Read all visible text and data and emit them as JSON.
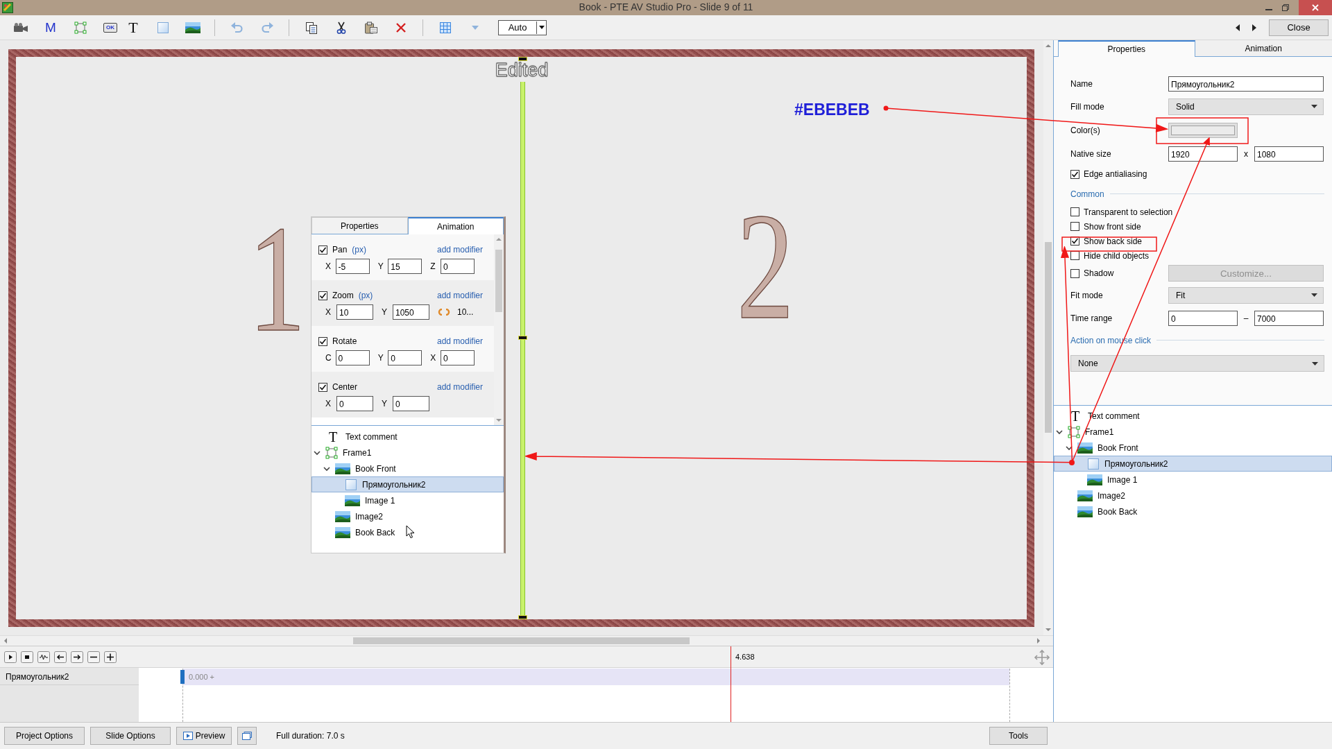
{
  "window": {
    "title": "Book - PTE AV Studio Pro - Slide 9 of 11"
  },
  "toolbar": {
    "tools": [
      {
        "kind": "camera"
      },
      {
        "kind": "glyph",
        "glyph": "M"
      },
      {
        "kind": "frame"
      },
      {
        "kind": "caption",
        "glyph": "OK"
      },
      {
        "kind": "glyph-serif",
        "glyph": "T"
      },
      {
        "kind": "rectangle"
      },
      {
        "kind": "image"
      },
      {
        "kind": "separator"
      },
      {
        "kind": "undo"
      },
      {
        "kind": "redo"
      },
      {
        "kind": "separator"
      },
      {
        "kind": "copy"
      },
      {
        "kind": "cut"
      },
      {
        "kind": "paste"
      },
      {
        "kind": "delete"
      },
      {
        "kind": "separator"
      },
      {
        "kind": "grid"
      },
      {
        "kind": "dropdown"
      }
    ],
    "zoom_select": "Auto",
    "close_button": "Close"
  },
  "slide": {
    "overlay_text": "Edited",
    "page_numbers": [
      "1",
      "2"
    ],
    "embedded_panel": {
      "tabs": [
        {
          "label": "Properties",
          "selected": false
        },
        {
          "label": "Animation",
          "selected": true
        }
      ],
      "sections": [
        {
          "label": "Pan",
          "unit": "(px)",
          "checked": true,
          "link": "add modifier",
          "fields": [
            {
              "axis": "X",
              "value": "-5"
            },
            {
              "axis": "Y",
              "value": "15"
            },
            {
              "axis": "Z",
              "value": "0"
            }
          ]
        },
        {
          "label": "Zoom",
          "unit": "(px)",
          "checked": true,
          "link": "add modifier",
          "fields": [
            {
              "axis": "X",
              "value": "10"
            },
            {
              "axis": "Y",
              "value": "1050"
            }
          ],
          "extra": "10..."
        },
        {
          "label": "Rotate",
          "checked": true,
          "link": "add modifier",
          "fields": [
            {
              "axis": "C",
              "value": "0"
            },
            {
              "axis": "Y",
              "value": "0"
            },
            {
              "axis": "X",
              "value": "0"
            }
          ]
        },
        {
          "label": "Center",
          "checked": true,
          "link": "add modifier",
          "fields": [
            {
              "axis": "X",
              "value": "0"
            },
            {
              "axis": "Y",
              "value": "0"
            }
          ]
        }
      ],
      "tree": [
        {
          "label": "Text comment",
          "kind": "text",
          "glyph": "T",
          "selected": false
        },
        {
          "label": "Frame1",
          "kind": "frame",
          "selected": false,
          "expanded": true,
          "children": [
            {
              "label": "Book Front",
              "kind": "image",
              "selected": false,
              "expanded": true,
              "children": [
                {
                  "label": "Прямоугольник2",
                  "kind": "rectangle",
                  "selected": true
                },
                {
                  "label": "Image 1",
                  "kind": "image",
                  "selected": false
                }
              ]
            },
            {
              "label": "Image2",
              "kind": "image",
              "selected": false
            },
            {
              "label": "Book Back",
              "kind": "image",
              "selected": false
            }
          ]
        }
      ]
    }
  },
  "annotations": {
    "color_label": "#EBEBEB"
  },
  "properties_panel": {
    "tabs": [
      {
        "label": "Properties",
        "selected": true
      },
      {
        "label": "Animation",
        "selected": false
      }
    ],
    "rows": [
      {
        "kind": "input",
        "label": "Name",
        "value": "Прямоугольник2"
      },
      {
        "kind": "select",
        "label": "Fill mode",
        "value": "Solid"
      },
      {
        "kind": "color",
        "label": "Color(s)"
      },
      {
        "kind": "pair",
        "label": "Native size",
        "value": "1920",
        "separator": "x",
        "value2": "1080"
      },
      {
        "kind": "checkbox",
        "label": "Edge antialiasing",
        "checked": true
      },
      {
        "kind": "section",
        "label": "Common"
      },
      {
        "kind": "checkbox",
        "label": "Transparent to selection",
        "checked": false
      },
      {
        "kind": "checkbox",
        "label": "Show front side",
        "checked": false
      },
      {
        "kind": "checkbox",
        "label": "Show back side",
        "checked": true
      },
      {
        "kind": "checkbox",
        "label": "Hide child objects",
        "checked": false
      },
      {
        "kind": "checkbox-button",
        "label": "Shadow",
        "checked": false,
        "button": "Customize...",
        "disabled": true
      },
      {
        "kind": "select",
        "label": "Fit mode",
        "value": "Fit"
      },
      {
        "kind": "pair",
        "label": "Time range",
        "value": "0",
        "separator": "–",
        "value2": "7000"
      },
      {
        "kind": "section",
        "label": "Action on mouse click"
      },
      {
        "kind": "select-wide",
        "value": "None"
      }
    ]
  },
  "object_tree": [
    {
      "label": "Text comment",
      "kind": "text",
      "glyph": "T",
      "selected": false
    },
    {
      "label": "Frame1",
      "kind": "frame",
      "selected": false,
      "expanded": true,
      "children": [
        {
          "label": "Book Front",
          "kind": "image",
          "selected": false,
          "expanded": true,
          "children": [
            {
              "label": "Прямоугольник2",
              "kind": "rectangle",
              "selected": true
            },
            {
              "label": "Image 1",
              "kind": "image",
              "selected": false
            }
          ]
        },
        {
          "label": "Image2",
          "kind": "image",
          "selected": false
        },
        {
          "label": "Book Back",
          "kind": "image",
          "selected": false
        }
      ]
    }
  ],
  "timeline": {
    "time_marker": "4.638",
    "track": {
      "name": "Прямоугольник2",
      "start_label": "0.000 +"
    }
  },
  "bottom_bar": {
    "buttons": [
      {
        "kind": "plain",
        "label": "Project Options"
      },
      {
        "kind": "plain",
        "label": "Slide Options"
      },
      {
        "kind": "preview",
        "label": "Preview"
      },
      {
        "kind": "icon"
      }
    ],
    "duration": "Full duration: 7.0 s",
    "tools_button": "Tools"
  }
}
